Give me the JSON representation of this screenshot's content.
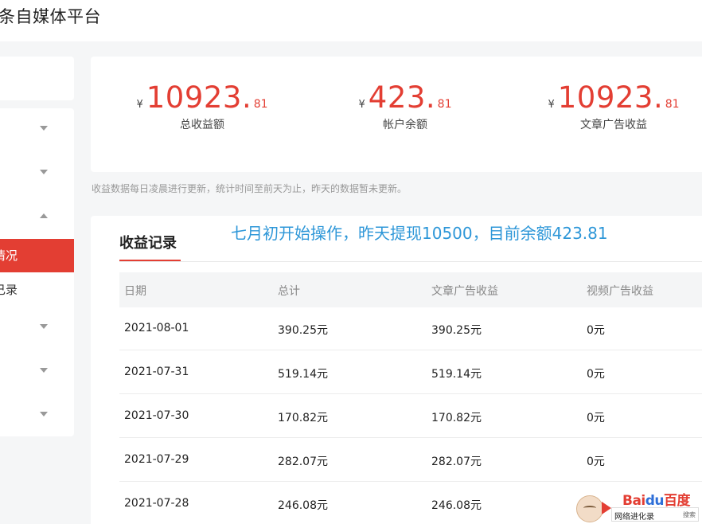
{
  "header": {
    "title": "条自媒体平台"
  },
  "sidebar": {
    "active_label": "情况",
    "item_label": "己录"
  },
  "stats": [
    {
      "yen": "¥",
      "int": "10923",
      "dot": ".",
      "dec": "81",
      "label": "总收益额"
    },
    {
      "yen": "¥",
      "int": "423",
      "dot": ".",
      "dec": "81",
      "label": "帐户余额"
    },
    {
      "yen": "¥",
      "int": "10923",
      "dot": ".",
      "dec": "81",
      "label": "文章广告收益"
    }
  ],
  "note": "收益数据每日凌晨进行更新，统计时间至前天为止，昨天的数据暂未更新。",
  "records": {
    "tab_label": "收益记录",
    "overlay_text": "七月初开始操作，昨天提现10500，目前余额423.81",
    "columns": [
      "日期",
      "总计",
      "文章广告收益",
      "视频广告收益"
    ],
    "rows": [
      [
        "2021-08-01",
        "390.25元",
        "390.25元",
        "0元"
      ],
      [
        "2021-07-31",
        "519.14元",
        "519.14元",
        "0元"
      ],
      [
        "2021-07-30",
        "170.82元",
        "170.82元",
        "0元"
      ],
      [
        "2021-07-29",
        "282.07元",
        "282.07元",
        "0元"
      ],
      [
        "2021-07-28",
        "246.08元",
        "246.08元",
        ""
      ]
    ]
  },
  "watermark": {
    "brand_bai": "Bai",
    "brand_du": "du",
    "brand_cn": "百度",
    "sub": "网络进化录",
    "search": "搜索"
  },
  "colors": {
    "accent": "#e33e33",
    "overlay_blue": "#2e97d8"
  }
}
